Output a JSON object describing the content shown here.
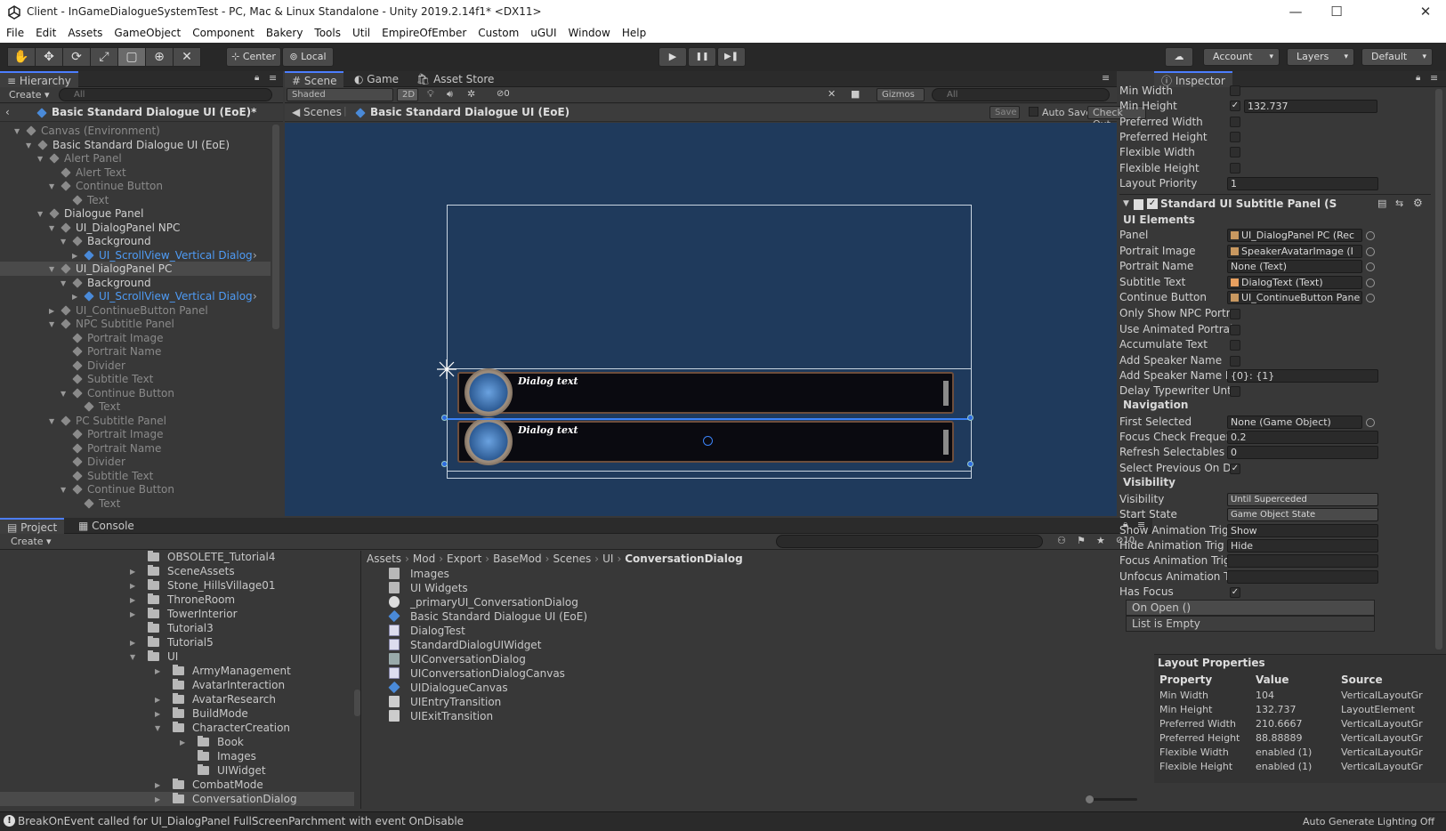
{
  "window": {
    "title": "Client - InGameDialogueSystemTest - PC, Mac & Linux Standalone - Unity 2019.2.14f1* <DX11>",
    "min": "—",
    "max": "☐",
    "close": "✕"
  },
  "menu": [
    "File",
    "Edit",
    "Assets",
    "GameObject",
    "Component",
    "Bakery",
    "Tools",
    "Util",
    "EmpireOfEmber",
    "Custom",
    "uGUI",
    "Window",
    "Help"
  ],
  "toolbar": {
    "tools": [
      "✋",
      "✥",
      "⟳",
      "⤢",
      "▢",
      "⊕",
      "✕"
    ],
    "center": "Center",
    "local": "Local",
    "play": "▶",
    "pause": "❚❚",
    "step": "▶❚",
    "account": "Account",
    "layers": "Layers",
    "layout": "Default"
  },
  "hierarchy": {
    "tab": "Hierarchy",
    "create": "Create",
    "search": "All",
    "breadcrumb": "Basic Standard Dialogue UI (EoE)*",
    "items": [
      {
        "label": "Canvas (Environment)",
        "depth": 0,
        "tri": "▼",
        "dim": true,
        "blue": false
      },
      {
        "label": "Basic Standard Dialogue UI (EoE)",
        "depth": 1,
        "tri": "▼",
        "dim": false,
        "blue": false
      },
      {
        "label": "Alert Panel",
        "depth": 2,
        "tri": "▼",
        "dim": true,
        "blue": false
      },
      {
        "label": "Alert Text",
        "depth": 3,
        "tri": "",
        "dim": true,
        "blue": false
      },
      {
        "label": "Continue Button",
        "depth": 3,
        "tri": "▼",
        "dim": true,
        "blue": false
      },
      {
        "label": "Text",
        "depth": 4,
        "tri": "",
        "dim": true,
        "blue": false
      },
      {
        "label": "Dialogue Panel",
        "depth": 2,
        "tri": "▼",
        "dim": false,
        "blue": false
      },
      {
        "label": "UI_DialogPanel NPC",
        "depth": 3,
        "tri": "▼",
        "dim": false,
        "blue": false
      },
      {
        "label": "Background",
        "depth": 4,
        "tri": "▼",
        "dim": false,
        "blue": false
      },
      {
        "label": "UI_ScrollView_Vertical Dialog",
        "depth": 5,
        "tri": "▶",
        "dim": false,
        "blue": true
      },
      {
        "label": "UI_DialogPanel PC",
        "depth": 3,
        "tri": "▼",
        "dim": false,
        "blue": false,
        "selected": true
      },
      {
        "label": "Background",
        "depth": 4,
        "tri": "▼",
        "dim": false,
        "blue": false
      },
      {
        "label": "UI_ScrollView_Vertical Dialog",
        "depth": 5,
        "tri": "▶",
        "dim": false,
        "blue": true
      },
      {
        "label": "UI_ContinueButton Panel",
        "depth": 3,
        "tri": "▶",
        "dim": true,
        "blue": false
      },
      {
        "label": "NPC Subtitle Panel",
        "depth": 3,
        "tri": "▼",
        "dim": true,
        "blue": false
      },
      {
        "label": "Portrait Image",
        "depth": 4,
        "tri": "",
        "dim": true,
        "blue": false
      },
      {
        "label": "Portrait Name",
        "depth": 4,
        "tri": "",
        "dim": true,
        "blue": false
      },
      {
        "label": "Divider",
        "depth": 4,
        "tri": "",
        "dim": true,
        "blue": false
      },
      {
        "label": "Subtitle Text",
        "depth": 4,
        "tri": "",
        "dim": true,
        "blue": false
      },
      {
        "label": "Continue Button",
        "depth": 4,
        "tri": "▼",
        "dim": true,
        "blue": false
      },
      {
        "label": "Text",
        "depth": 5,
        "tri": "",
        "dim": true,
        "blue": false
      },
      {
        "label": "PC Subtitle Panel",
        "depth": 3,
        "tri": "▼",
        "dim": true,
        "blue": false
      },
      {
        "label": "Portrait Image",
        "depth": 4,
        "tri": "",
        "dim": true,
        "blue": false
      },
      {
        "label": "Portrait Name",
        "depth": 4,
        "tri": "",
        "dim": true,
        "blue": false
      },
      {
        "label": "Divider",
        "depth": 4,
        "tri": "",
        "dim": true,
        "blue": false
      },
      {
        "label": "Subtitle Text",
        "depth": 4,
        "tri": "",
        "dim": true,
        "blue": false
      },
      {
        "label": "Continue Button",
        "depth": 4,
        "tri": "▼",
        "dim": true,
        "blue": false
      },
      {
        "label": "Text",
        "depth": 5,
        "tri": "",
        "dim": true,
        "blue": false
      }
    ]
  },
  "scene": {
    "tabs": [
      "Scene",
      "Game",
      "Asset Store"
    ],
    "shading": "Shaded",
    "mode2d": "2D",
    "hidden": "0",
    "gizmos": "Gizmos",
    "search": "All",
    "breadcrumb_root": "Scenes",
    "breadcrumb": "Basic Standard Dialogue UI (EoE)",
    "save": "Save",
    "autosave": "Auto Save",
    "checkout": "Check Out",
    "dialog_text_1": "Dialog text",
    "dialog_text_2": "Dialog text"
  },
  "inspector": {
    "tab": "Inspector",
    "top_rows": [
      {
        "label": "Min Width",
        "checked": false,
        "value": ""
      },
      {
        "label": "Min Height",
        "checked": true,
        "value": "132.737"
      },
      {
        "label": "Preferred Width",
        "checked": false,
        "value": ""
      },
      {
        "label": "Preferred Height",
        "checked": false,
        "value": ""
      },
      {
        "label": "Flexible Width",
        "checked": false,
        "value": ""
      },
      {
        "label": "Flexible Height",
        "checked": false,
        "value": ""
      }
    ],
    "layout_priority_label": "Layout Priority",
    "layout_priority": "1",
    "component": "Standard UI Subtitle Panel (S",
    "sec_ui": "UI Elements",
    "ui_rows": [
      {
        "label": "Panel",
        "value": "UI_DialogPanel PC (Rec"
      },
      {
        "label": "Portrait Image",
        "value": "SpeakerAvatarImage (I"
      },
      {
        "label": "Portrait Name",
        "value": "None (Text)"
      },
      {
        "label": "Subtitle Text",
        "value": "DialogText (Text)"
      },
      {
        "label": "Continue Button",
        "value": "UI_ContinueButton Pane"
      }
    ],
    "bool_rows": [
      {
        "label": "Only Show NPC Portr",
        "checked": false
      },
      {
        "label": "Use Animated Portrai",
        "checked": false
      },
      {
        "label": "Accumulate Text",
        "checked": false
      },
      {
        "label": "Add Speaker Name",
        "checked": false
      }
    ],
    "speaker_fmt_label": "Add Speaker Name F",
    "speaker_fmt": "{0}: {1}",
    "delay_label": "Delay Typewriter Unt",
    "sec_nav": "Navigation",
    "first_selected_label": "First Selected",
    "first_selected": "None (Game Object)",
    "focus_label": "Focus Check Frequer",
    "focus": "0.2",
    "refresh_label": "Refresh Selectables I",
    "refresh": "0",
    "select_prev_label": "Select Previous On D",
    "sec_vis": "Visibility",
    "visibility_label": "Visibility",
    "visibility": "Until Superceded",
    "start_state_label": "Start State",
    "start_state": "Game Object State",
    "show_anim_label": "Show Animation Trig",
    "show_anim": "Show",
    "hide_anim_label": "Hide Animation Trig",
    "hide_anim": "Hide",
    "focus_anim_label": "Focus Animation Trig",
    "focus_anim": "",
    "unfocus_anim_label": "Unfocus Animation Tr",
    "unfocus_anim": "",
    "has_focus_label": "Has Focus",
    "on_open": "On Open ()",
    "list_empty": "List is Empty",
    "layout_props_title": "Layout Properties",
    "lp_headers": [
      "Property",
      "Value",
      "Source"
    ],
    "lp_rows": [
      [
        "Min Width",
        "104",
        "VerticalLayoutGr"
      ],
      [
        "Min Height",
        "132.737",
        "LayoutElement"
      ],
      [
        "Preferred Width",
        "210.6667",
        "VerticalLayoutGr"
      ],
      [
        "Preferred Height",
        "88.88889",
        "VerticalLayoutGr"
      ],
      [
        "Flexible Width",
        "enabled (1)",
        "VerticalLayoutGr"
      ],
      [
        "Flexible Height",
        "enabled (1)",
        "VerticalLayoutGr"
      ]
    ]
  },
  "project": {
    "tabs": [
      "Project",
      "Console"
    ],
    "create": "Create",
    "filter_count": "10",
    "tree": [
      {
        "label": "OBSOLETE_Tutorial4",
        "depth": 0,
        "tri": ""
      },
      {
        "label": "SceneAssets",
        "depth": 0,
        "tri": "▶"
      },
      {
        "label": "Stone_HillsVillage01",
        "depth": 0,
        "tri": "▶"
      },
      {
        "label": "ThroneRoom",
        "depth": 0,
        "tri": "▶"
      },
      {
        "label": "TowerInterior",
        "depth": 0,
        "tri": "▶"
      },
      {
        "label": "Tutorial3",
        "depth": 0,
        "tri": ""
      },
      {
        "label": "Tutorial5",
        "depth": 0,
        "tri": "▶"
      },
      {
        "label": "UI",
        "depth": 0,
        "tri": "▼"
      },
      {
        "label": "ArmyManagement",
        "depth": 1,
        "tri": "▶"
      },
      {
        "label": "AvatarInteraction",
        "depth": 1,
        "tri": ""
      },
      {
        "label": "AvatarResearch",
        "depth": 1,
        "tri": "▶"
      },
      {
        "label": "BuildMode",
        "depth": 1,
        "tri": "▶"
      },
      {
        "label": "CharacterCreation",
        "depth": 1,
        "tri": "▼"
      },
      {
        "label": "Book",
        "depth": 2,
        "tri": "▶"
      },
      {
        "label": "Images",
        "depth": 2,
        "tri": ""
      },
      {
        "label": "UIWidget",
        "depth": 2,
        "tri": ""
      },
      {
        "label": "CombatMode",
        "depth": 1,
        "tri": "▶"
      },
      {
        "label": "ConversationDialog",
        "depth": 1,
        "tri": "▶",
        "selected": true
      }
    ],
    "path": [
      "Assets",
      "Mod",
      "Export",
      "BaseMod",
      "Scenes",
      "UI",
      "ConversationDialog"
    ],
    "files": [
      {
        "label": "Images",
        "kind": "folder"
      },
      {
        "label": "UI Widgets",
        "kind": "folder"
      },
      {
        "label": "_primaryUI_ConversationDialog",
        "kind": "unity"
      },
      {
        "label": "Basic Standard Dialogue UI (EoE)",
        "kind": "prefab"
      },
      {
        "label": "DialogTest",
        "kind": "script"
      },
      {
        "label": "StandardDialogUIWidget",
        "kind": "script"
      },
      {
        "label": "UIConversationDialog",
        "kind": "anim"
      },
      {
        "label": "UIConversationDialogCanvas",
        "kind": "script"
      },
      {
        "label": "UIDialogueCanvas",
        "kind": "prefab"
      },
      {
        "label": "UIEntryTransition",
        "kind": "clip"
      },
      {
        "label": "UIExitTransition",
        "kind": "clip"
      }
    ]
  },
  "status": {
    "message": "BreakOnEvent called for UI_DialogPanel FullScreenParchment with event OnDisable",
    "lighting": "Auto Generate Lighting Off"
  }
}
